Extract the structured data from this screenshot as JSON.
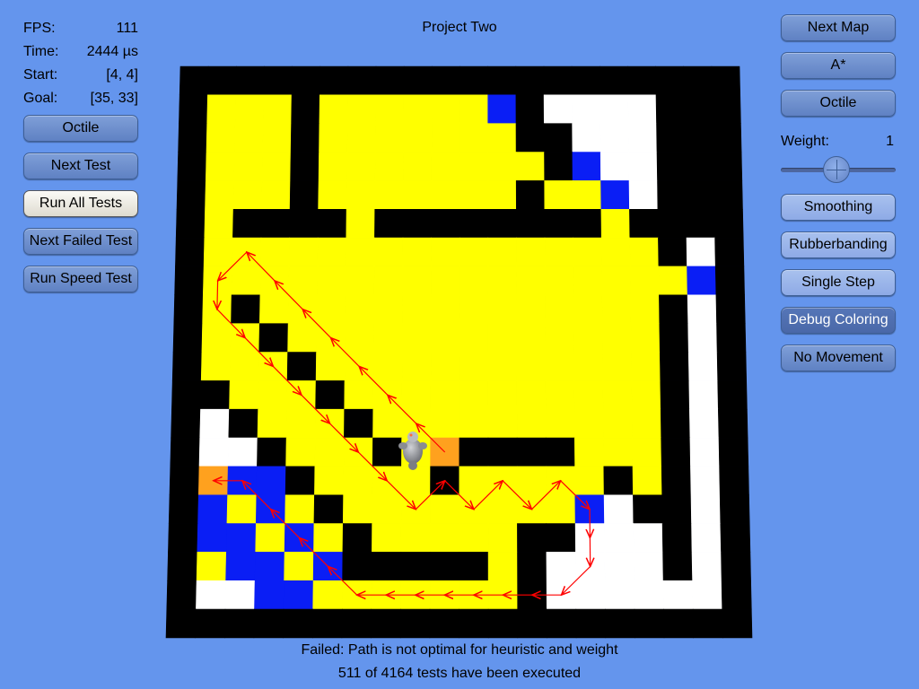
{
  "title": "Project Two",
  "stats": [
    {
      "key": "FPS:",
      "value": "111"
    },
    {
      "key": "Time:",
      "value": "2444 µs"
    },
    {
      "key": "Start:",
      "value": "[4, 4]"
    },
    {
      "key": "Goal:",
      "value": "[35, 33]"
    }
  ],
  "left_buttons": {
    "heuristic": "Octile",
    "next_test": "Next Test",
    "run_all_tests": "Run All Tests",
    "next_failed_test": "Next Failed Test",
    "run_speed_test": "Run Speed Test"
  },
  "right_buttons": {
    "next_map": "Next Map",
    "algorithm": "A*",
    "heuristic": "Octile",
    "smoothing": "Smoothing",
    "rubberbanding": "Rubberbanding",
    "single_step": "Single Step",
    "debug_coloring": "Debug Coloring",
    "no_movement": "No Movement"
  },
  "weight": {
    "label": "Weight:",
    "value": "1"
  },
  "status": {
    "message": "Failed: Path is not optimal for heuristic and weight",
    "progress": "511 of 4164 tests have been executed"
  },
  "colors": {
    "background": "#6495ED",
    "wall": "#000000",
    "open": "#FFFFFF",
    "visited": "#FFFF00",
    "frontier": "#0A1EF5",
    "start_goal": "#FFA11E",
    "path_arrow": "#FF0000"
  },
  "map": {
    "legend": {
      "W": "wall",
      ".": "open",
      "Y": "visited",
      "B": "frontier",
      "O": "start/goal"
    },
    "rows": [
      "WWWWWWWWWWWWWWWWWWWW",
      "WYYYWYYYYYYBW....WWW",
      "WYYYWYYYYYYYWW...WWW",
      "WYYYWYYYYYYYYWB..WWW",
      "WYYYWYYYYYYYWYYB.WWW",
      "WYWWWWYWWWWWWWWYWWWW",
      "WYYYYYYYYYYYYYYYYW.W",
      "WYYYYYYYYYYYYYYYYYBW",
      "WYWYYYYYYYYYYYYYYW.W",
      "WYYWYYYYYYYYYYYYYW.W",
      "WYYYWYYYYYYYYYYYYW.W",
      "WWYYYWYYYYYYYYYYYW.W",
      "W.WYYYWYYYYYYYYYYW.W",
      "W..WYYYWYOWWWWYYYW.W",
      "WOBBWYYYYWYYYYYWYW.W",
      "WBYBYWYYYYYYYYB.WW.W",
      "WBBYBYWYYYYYWW...W.W",
      "WYBBYBWWWWWYW....W.W",
      "W..BBYYYYYYYW......W",
      "WWWWWWWWWWWWWWWWWWWW"
    ]
  },
  "path": [
    [
      9.5,
      13.5
    ],
    [
      8.5,
      12.5
    ],
    [
      7.5,
      11.5
    ],
    [
      6.5,
      10.5
    ],
    [
      5.5,
      9.5
    ],
    [
      4.5,
      8.5
    ],
    [
      3.5,
      7.5
    ],
    [
      2.5,
      6.5
    ],
    [
      1.5,
      7.5
    ],
    [
      1.5,
      8.5
    ],
    [
      2.5,
      9.5
    ],
    [
      3.5,
      10.5
    ],
    [
      4.5,
      11.5
    ],
    [
      5.5,
      12.5
    ],
    [
      6.5,
      13.5
    ],
    [
      7.5,
      14.5
    ],
    [
      8.5,
      15.5
    ],
    [
      9.5,
      14.5
    ],
    [
      10.5,
      15.5
    ],
    [
      11.5,
      14.5
    ],
    [
      12.5,
      15.5
    ],
    [
      13.5,
      14.5
    ],
    [
      14.5,
      15.5
    ],
    [
      14.5,
      16.5
    ],
    [
      14.5,
      17.5
    ],
    [
      13.5,
      18.5
    ],
    [
      12.5,
      18.5
    ],
    [
      11.5,
      18.5
    ],
    [
      10.5,
      18.5
    ],
    [
      9.5,
      18.5
    ],
    [
      8.5,
      18.5
    ],
    [
      7.5,
      18.5
    ],
    [
      6.5,
      18.5
    ],
    [
      5.5,
      17.5
    ],
    [
      4.5,
      16.5
    ],
    [
      3.5,
      15.5
    ],
    [
      2.5,
      14.5
    ],
    [
      1.5,
      14.5
    ]
  ]
}
